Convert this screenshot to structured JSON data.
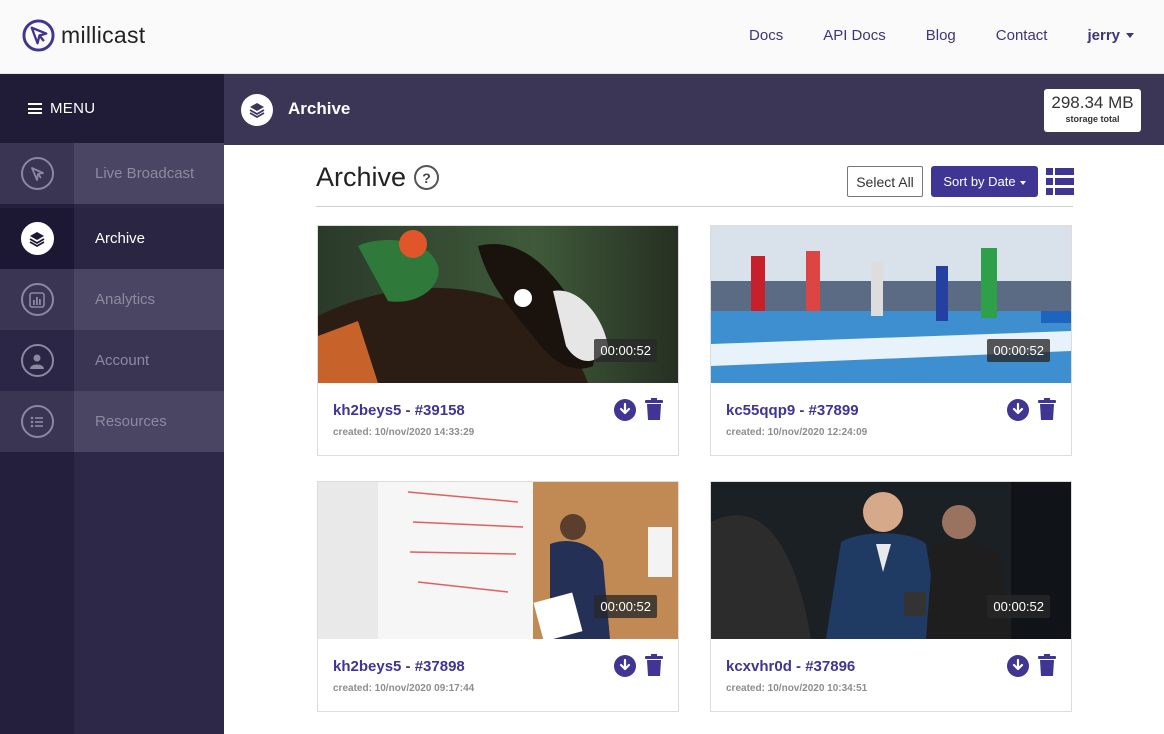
{
  "app": {
    "logo_text": "millicast"
  },
  "topnav": {
    "links": [
      "Docs",
      "API Docs",
      "Blog",
      "Contact"
    ],
    "user": "jerry"
  },
  "sidebar": {
    "menu_label": "MENU",
    "items": [
      {
        "label": "Live Broadcast",
        "icon": "millicast-logo-icon"
      },
      {
        "label": "Archive",
        "icon": "layers-icon",
        "active": true
      },
      {
        "label": "Analytics",
        "icon": "bar-chart-icon"
      },
      {
        "label": "Account",
        "icon": "user-icon"
      },
      {
        "label": "Resources",
        "icon": "list-icon"
      }
    ]
  },
  "page_header": {
    "title": "Archive",
    "storage_value": "298.34 MB",
    "storage_label": "storage total"
  },
  "content": {
    "title": "Archive",
    "help": "?",
    "select_all": "Select All",
    "sort_label": "Sort by Date"
  },
  "cards": [
    {
      "title": "kh2beys5 - #39158",
      "created": "created: 10/nov/2020 14:33:29",
      "duration": "00:00:52",
      "thumbnail": "horse-racing"
    },
    {
      "title": "kc55qqp9 - #37899",
      "created": "created: 10/nov/2020 12:24:09",
      "duration": "00:00:52",
      "thumbnail": "steeplechase-race"
    },
    {
      "title": "kh2beys5 - #37898",
      "created": "created: 10/nov/2020 09:17:44",
      "duration": "00:00:52",
      "thumbnail": "whiteboard-presenter"
    },
    {
      "title": "kcxvhr0d - #37896",
      "created": "created: 10/nov/2020 10:34:51",
      "duration": "00:00:52",
      "thumbnail": "news-reporter"
    }
  ],
  "colors": {
    "brand": "#3f3592",
    "header_bar": "#3b3656",
    "sidebar": "#2d2847"
  }
}
